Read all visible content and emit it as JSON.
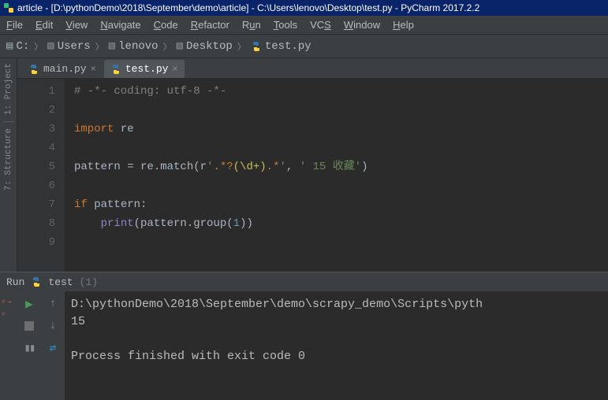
{
  "title": "article - [D:\\pythonDemo\\2018\\September\\demo\\article] - C:\\Users\\lenovo\\Desktop\\test.py - PyCharm 2017.2.2",
  "menu": [
    "File",
    "Edit",
    "View",
    "Navigate",
    "Code",
    "Refactor",
    "Run",
    "Tools",
    "VCS",
    "Window",
    "Help"
  ],
  "breadcrumb": {
    "root": "C:",
    "parts": [
      "Users",
      "lenovo",
      "Desktop"
    ],
    "file": "test.py"
  },
  "sidebar": {
    "project": "1: Project",
    "structure": "7: Structure"
  },
  "tabs": [
    {
      "label": "main.py",
      "active": false
    },
    {
      "label": "test.py",
      "active": true
    }
  ],
  "code": {
    "lines": [
      "1",
      "2",
      "3",
      "4",
      "5",
      "6",
      "7",
      "8",
      "9"
    ],
    "l1": "# -*- coding: utf-8 -*-",
    "l3_import": "import",
    "l3_mod": " re",
    "l5_a": "pattern = re.match(r",
    "l5_s1": "'",
    "l5_s2": ".*?",
    "l5_s3": "(\\d+)",
    "l5_s4": ".*",
    "l5_s5": "'",
    "l5_c": ", ",
    "l5_t": "' 15 收藏'",
    "l5_e": ")",
    "l7_if": "if",
    "l7_b": " pattern:",
    "l8_a": "    ",
    "l8_print": "print",
    "l8_b": "(pattern.group(",
    "l8_n": "1",
    "l8_c": "))"
  },
  "run": {
    "label": "Run",
    "config": "test",
    "count": "(1)",
    "out1": "D:\\pythonDemo\\2018\\September\\demo\\scrapy_demo\\Scripts\\pyth",
    "out2": "15",
    "out3": "",
    "out4": "Process finished with exit code 0"
  }
}
